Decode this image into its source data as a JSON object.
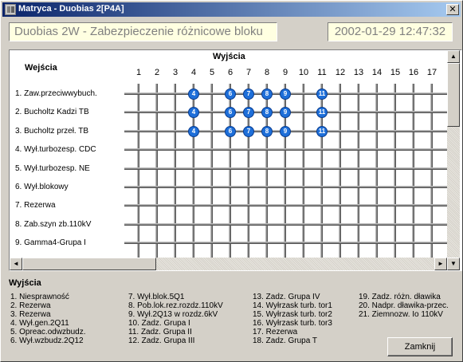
{
  "window": {
    "title": "Matryca - Duobias 2[P4A]",
    "close_glyph": "✕"
  },
  "header": {
    "device_title": "Duobias 2W - Zabezpieczenie różnicowe bloku",
    "datetime": "2002-01-29 12:47:32"
  },
  "matrix": {
    "inputs_label": "Wejścia",
    "outputs_label": "Wyjścia",
    "columns": [
      "1",
      "2",
      "3",
      "4",
      "5",
      "6",
      "7",
      "8",
      "9",
      "10",
      "11",
      "12",
      "13",
      "14",
      "15",
      "16",
      "17"
    ],
    "rows": [
      "1. Zaw.przeciwwybuch.",
      "2. Bucholtz Kadzi TB",
      "3. Bucholtz przeł. TB",
      "4. Wył.turbozesp. CDC",
      "5. Wył.turbozesp. NE",
      "6. Wył.blokowy",
      "7. Rezerwa",
      "8. Zab.szyn zb.110kV",
      "9. Gamma4-Grupa I"
    ],
    "active": [
      {
        "row": 1,
        "cols": [
          4,
          6,
          7,
          8,
          9,
          11
        ]
      },
      {
        "row": 2,
        "cols": [
          4,
          6,
          7,
          8,
          9,
          11
        ]
      },
      {
        "row": 3,
        "cols": [
          4,
          6,
          7,
          8,
          9,
          11
        ]
      }
    ],
    "dot_color": "#1e6fd9"
  },
  "scrollbars": {
    "up_arrow": "▲",
    "down_arrow": "▼",
    "left_arrow": "◄",
    "right_arrow": "►"
  },
  "legend": {
    "title": "Wyjścia",
    "items": [
      "1. Niesprawność",
      "2. Rezerwa",
      "3. Rezerwa",
      "4. Wył.gen.2Q11",
      "5. Opreac.odwzbudz.",
      "6. Wył.wzbudz.2Q12",
      "7. Wył.blok.5Q1",
      "8. Pob.lok.rez.rozdz.110kV",
      "9. Wył.2Q13 w rozdz.6kV",
      "10. Zadz. Grupa I",
      "11. Zadz. Grupa II",
      "12. Zadz. Grupa III",
      "13. Zadz. Grupa IV",
      "14. Wyłrzask turb. tor1",
      "15. Wyłrzask turb. tor2",
      "16. Wyłrzask turb. tor3",
      "17. Rezerwa",
      "18. Zadz. Grupa T",
      "19. Zadz. różn. dławika",
      "20. Nadpr. dławika-przec.",
      "21. Ziemnozw. Io 110kV"
    ]
  },
  "buttons": {
    "close_label": "Zamknij"
  }
}
